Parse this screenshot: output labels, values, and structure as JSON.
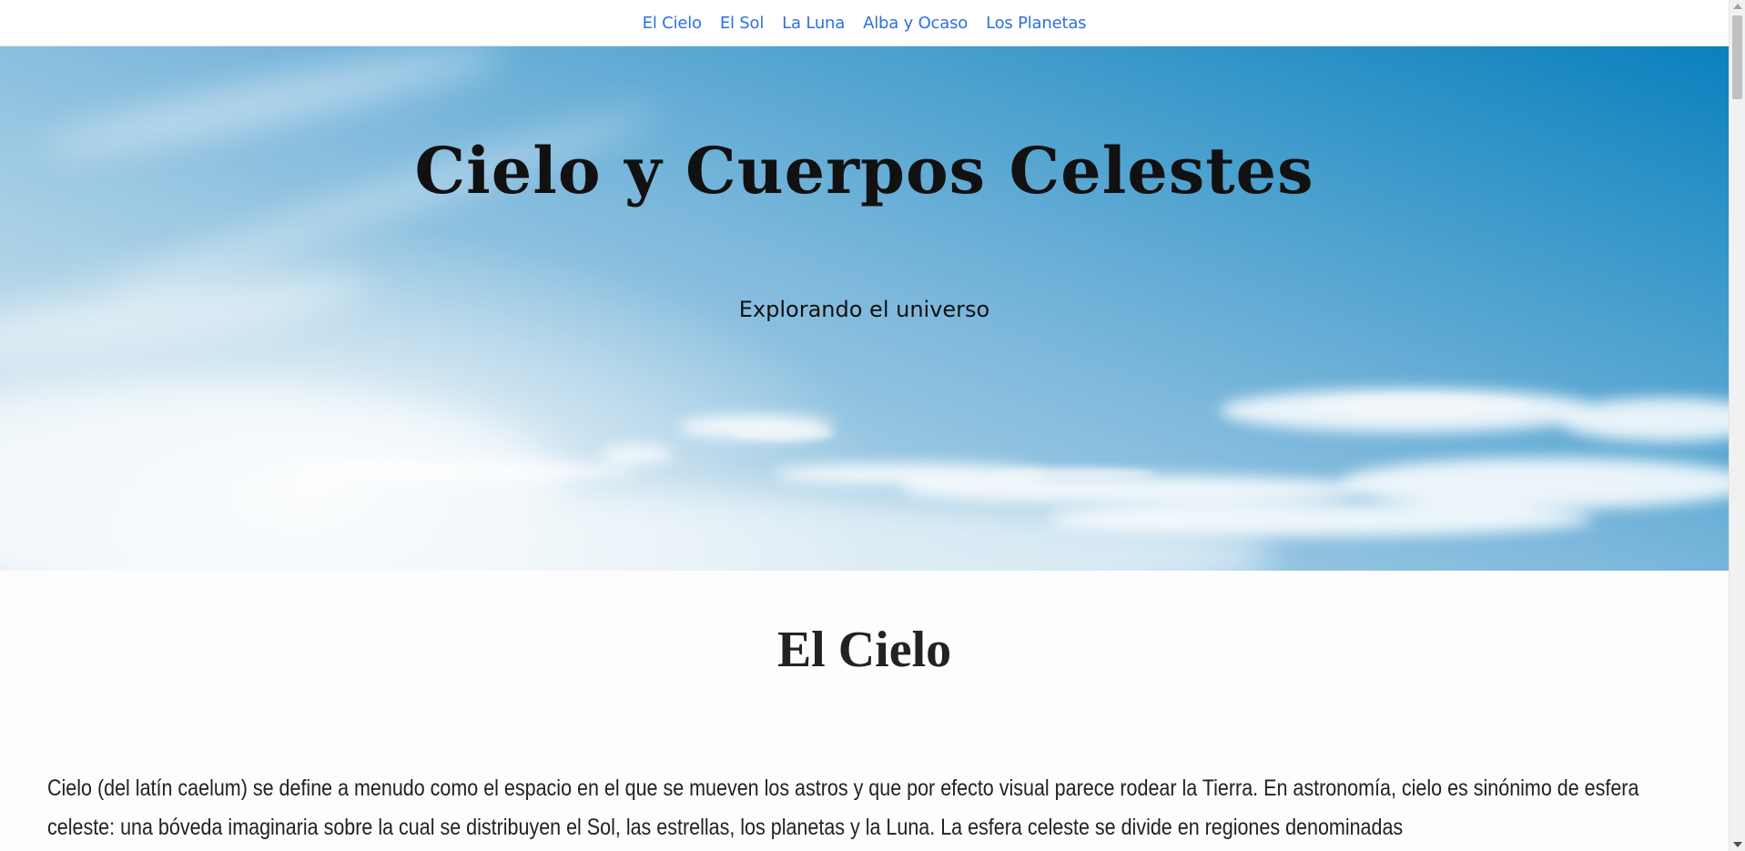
{
  "nav": {
    "items": [
      {
        "label": "El Cielo"
      },
      {
        "label": "El Sol"
      },
      {
        "label": "La Luna"
      },
      {
        "label": "Alba y Ocaso"
      },
      {
        "label": "Los Planetas"
      }
    ]
  },
  "hero": {
    "title": "Cielo y Cuerpos Celestes",
    "subtitle": "Explorando el universo"
  },
  "section": {
    "heading": "El Cielo",
    "paragraph": "Cielo (del latín caelum) se define a menudo como el espacio en el que se mueven los astros y que por efecto visual parece rodear la Tierra. En astronomía, cielo es sinónimo de esfera celeste: una bóveda imaginaria sobre la cual se distribuyen el Sol, las estrellas, los planetas y la Luna. La esfera celeste se divide en regiones denominadas"
  },
  "colors": {
    "link": "#2f6fe0",
    "sky_top": "#0a80bd",
    "sky_bottom": "#d7e7ef",
    "text": "#222222"
  }
}
